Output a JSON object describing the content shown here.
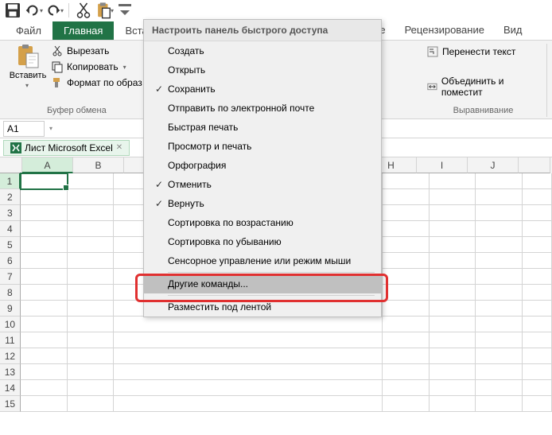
{
  "qat": {
    "tooltip": ""
  },
  "tabs": {
    "file": "Файл",
    "home": "Главная",
    "insert": "Вста",
    "data_partial": "ые",
    "review": "Рецензирование",
    "view": "Вид"
  },
  "clipboard": {
    "paste": "Вставить",
    "cut": "Вырезать",
    "copy": "Копировать",
    "format_painter": "Формат по образ",
    "group_label": "Буфер обмена"
  },
  "alignment": {
    "wrap": "Перенести текст",
    "merge": "Объединить и поместит",
    "group_label": "Выравнивание"
  },
  "name_box": "A1",
  "sheet_tab": "Лист Microsoft Excel",
  "columns": [
    "A",
    "B",
    "H",
    "I",
    "J"
  ],
  "rows": [
    1,
    2,
    3,
    4,
    5,
    6,
    7,
    8,
    9,
    10,
    11,
    12,
    13,
    14,
    15
  ],
  "menu": {
    "title": "Настроить панель быстрого доступа",
    "items": [
      {
        "label": "Создать",
        "checked": false
      },
      {
        "label": "Открыть",
        "checked": false
      },
      {
        "label": "Сохранить",
        "checked": true
      },
      {
        "label": "Отправить по электронной почте",
        "checked": false
      },
      {
        "label": "Быстрая печать",
        "checked": false
      },
      {
        "label": "Просмотр и печать",
        "checked": false
      },
      {
        "label": "Орфография",
        "checked": false
      },
      {
        "label": "Отменить",
        "checked": true
      },
      {
        "label": "Вернуть",
        "checked": true
      },
      {
        "label": "Сортировка по возрастанию",
        "checked": false
      },
      {
        "label": "Сортировка по убыванию",
        "checked": false
      },
      {
        "label": "Сенсорное управление или режим мыши",
        "checked": false
      },
      {
        "label": "Другие команды...",
        "checked": false,
        "hovered": true
      },
      {
        "label": "Разместить под лентой",
        "checked": false
      }
    ]
  }
}
